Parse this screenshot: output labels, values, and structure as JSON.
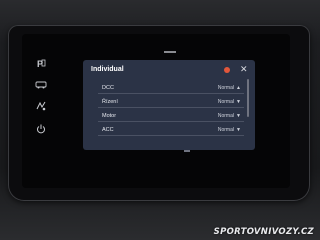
{
  "dialog": {
    "title": "Individual",
    "rows": [
      {
        "label": "DCC",
        "value": "Normal",
        "chevron": "▲"
      },
      {
        "label": "Řízení",
        "value": "Normal",
        "chevron": "▼"
      },
      {
        "label": "Motor",
        "value": "Normal",
        "chevron": "▼"
      },
      {
        "label": "ACC",
        "value": "Normal",
        "chevron": "▼"
      }
    ],
    "close_glyph": "✕"
  },
  "sidebar": {
    "icons": [
      "parking-icon",
      "driving-mode-icon",
      "assist-icon",
      "power-icon"
    ]
  },
  "colors": {
    "panel_bg": "#2b3346",
    "accent_dot": "#e2573b"
  },
  "watermark": "SPORTOVNIVOZY.CZ"
}
